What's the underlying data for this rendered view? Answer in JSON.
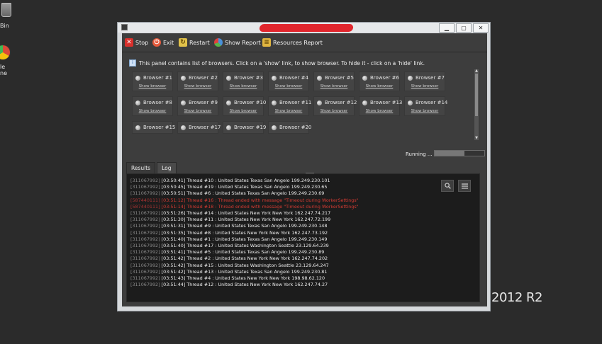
{
  "desktop": {
    "recycle_bin_label": "Bin",
    "chrome_label_1": "le",
    "chrome_label_2": "ne",
    "watermark": "2012 R2"
  },
  "window": {
    "controls": {
      "minimize": "▁",
      "maximize": "▢",
      "close": "✕"
    }
  },
  "toolbar": {
    "stop": "Stop",
    "exit": "Exit",
    "restart": "Restart",
    "show_report": "Show Report",
    "resources_report": "Resources Report"
  },
  "panel": {
    "info": "This panel contains list of browsers. Click on a 'show' link, to show browser. To hide it - click on a 'hide' link.",
    "show_link": "Show browser",
    "browsers": [
      "Browser #1",
      "Browser #2",
      "Browser #3",
      "Browser #4",
      "Browser #5",
      "Browser #6",
      "Browser #7",
      "Browser #8",
      "Browser #9",
      "Browser #10",
      "Browser #11",
      "Browser #12",
      "Browser #13",
      "Browser #14",
      "Browser #15",
      "Browser #17",
      "Browser #19",
      "Browser #20"
    ],
    "status": "Running ...",
    "progress": 0.6
  },
  "tabs": [
    "Results",
    "Log"
  ],
  "log": [
    {
      "pid": "[311067992]",
      "text": "[03:50:41] Thread #10 : United States Texas San Angelo 199.249.230.101",
      "err": false
    },
    {
      "pid": "[311067992]",
      "text": "[03:50:45] Thread #19 : United States Texas San Angelo 199.249.230.65",
      "err": false
    },
    {
      "pid": "[311067992]",
      "text": "[03:50:51] Thread #6 : United States Texas San Angelo 199.249.230.69",
      "err": false
    },
    {
      "pid": "[587440111]",
      "text": "[03:51:12] Thread #16 : Thread ended with message \"Timeout during WorkerSettings\"",
      "err": true
    },
    {
      "pid": "[587440111]",
      "text": "[03:51:14] Thread #18 : Thread ended with message \"Timeout during WorkerSettings\"",
      "err": true
    },
    {
      "pid": "[311067992]",
      "text": "[03:51:26] Thread #14 : United States New York New York 162.247.74.217",
      "err": false
    },
    {
      "pid": "[311067992]",
      "text": "[03:51:30] Thread #11 : United States New York New York 162.247.72.199",
      "err": false
    },
    {
      "pid": "[311067992]",
      "text": "[03:51:31] Thread #9 : United States Texas San Angelo 199.249.230.148",
      "err": false
    },
    {
      "pid": "[311067992]",
      "text": "[03:51:35] Thread #8 : United States New York New York 162.247.73.192",
      "err": false
    },
    {
      "pid": "[311067992]",
      "text": "[03:51:40] Thread #1 : United States Texas San Angelo 199.249.230.149",
      "err": false
    },
    {
      "pid": "[311067992]",
      "text": "[03:51:40] Thread #17 : United States Washington Seattle 23.129.64.239",
      "err": false
    },
    {
      "pid": "[311067992]",
      "text": "[03:51:41] Thread #5 : United States Texas San Angelo 199.249.230.89",
      "err": false
    },
    {
      "pid": "[311067992]",
      "text": "[03:51:42] Thread #2 : United States New York New York 162.247.74.202",
      "err": false
    },
    {
      "pid": "[311067992]",
      "text": "[03:51:42] Thread #15 : United States Washington Seattle 23.129.64.247",
      "err": false
    },
    {
      "pid": "[311067992]",
      "text": "[03:51:42] Thread #13 : United States Texas San Angelo 199.249.230.81",
      "err": false
    },
    {
      "pid": "[311067992]",
      "text": "[03:51:43] Thread #4 : United States New York New York 198.98.62.120",
      "err": false
    },
    {
      "pid": "[311067992]",
      "text": "[03:51:44] Thread #12 : United States New York New York 162.247.74.27",
      "err": false
    }
  ]
}
